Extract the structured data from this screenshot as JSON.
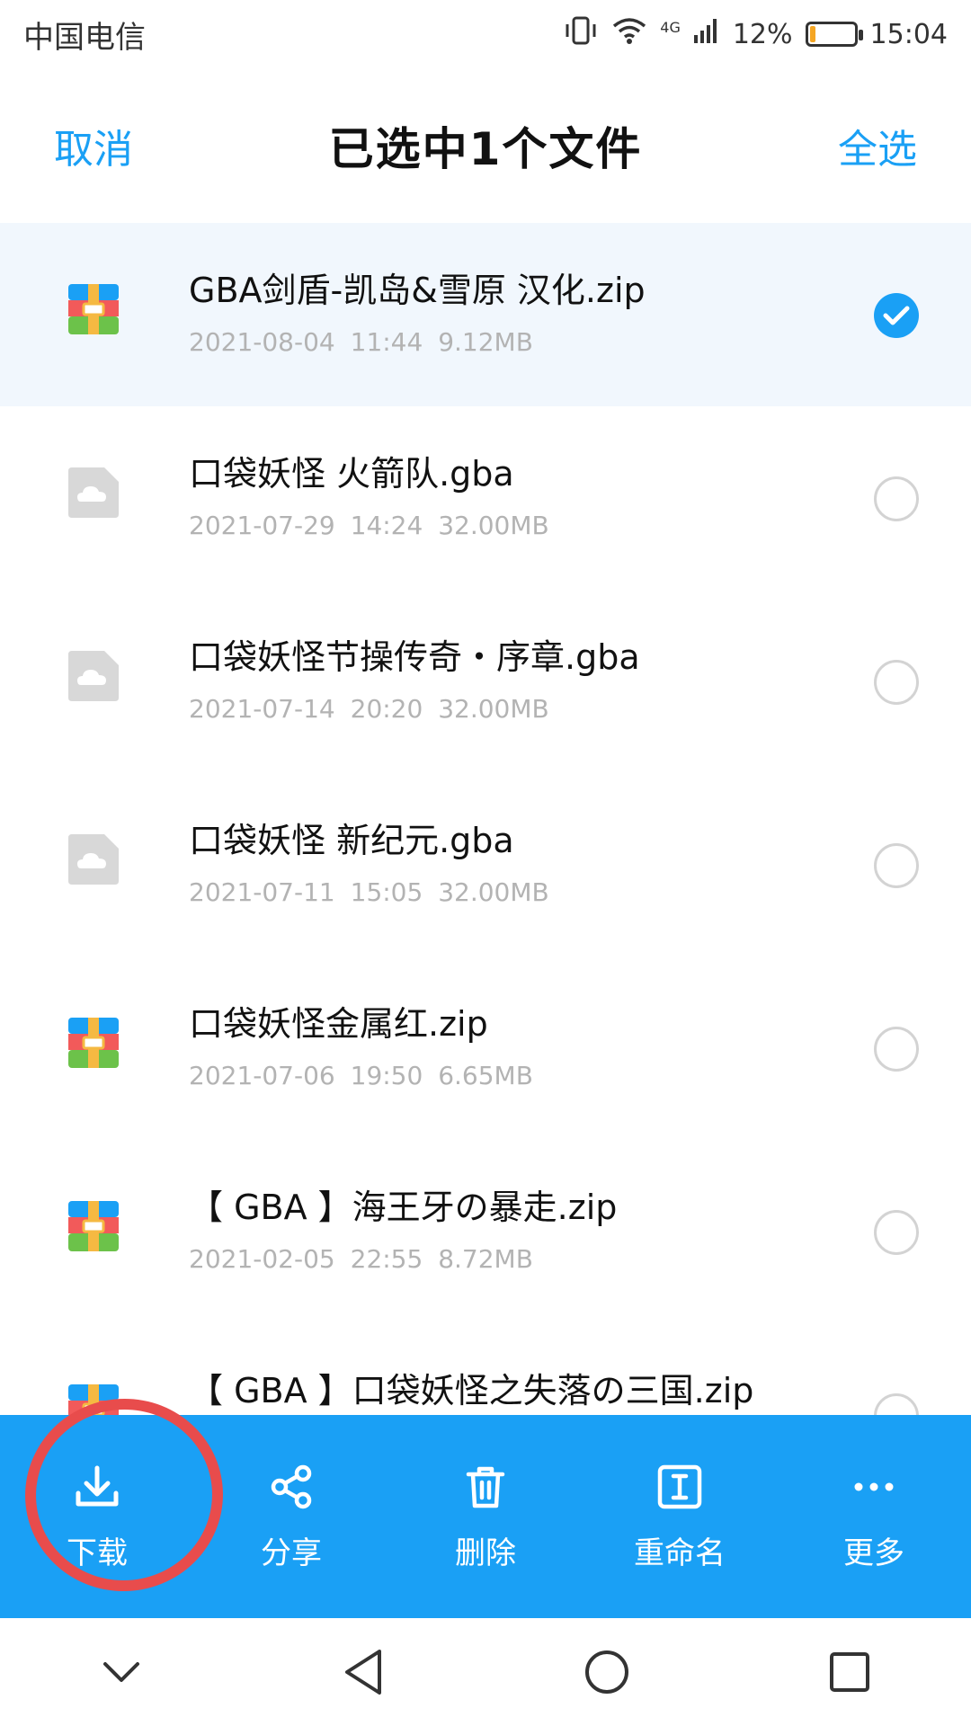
{
  "status_bar": {
    "carrier": "中国电信",
    "network": "4G",
    "battery_percent": "12%",
    "battery_level": 0.12,
    "time": "15:04"
  },
  "header": {
    "cancel_label": "取消",
    "title": "已选中1个文件",
    "select_all_label": "全选"
  },
  "files": [
    {
      "name": "GBA剑盾-凯岛&雪原 汉化.zip",
      "meta": "2021-08-04  11:44  9.12MB",
      "type": "archive",
      "selected": true
    },
    {
      "name": "口袋妖怪 火箭队.gba",
      "meta": "2021-07-29  14:24  32.00MB",
      "type": "cloud-file",
      "selected": false
    },
    {
      "name": "口袋妖怪节操传奇・序章.gba",
      "meta": "2021-07-14  20:20  32.00MB",
      "type": "cloud-file",
      "selected": false
    },
    {
      "name": "口袋妖怪 新纪元.gba",
      "meta": "2021-07-11  15:05  32.00MB",
      "type": "cloud-file",
      "selected": false
    },
    {
      "name": "口袋妖怪金属红.zip",
      "meta": "2021-07-06  19:50  6.65MB",
      "type": "archive",
      "selected": false
    },
    {
      "name": "【 GBA 】海王牙の暴走.zip",
      "meta": "2021-02-05  22:55  8.72MB",
      "type": "archive",
      "selected": false
    },
    {
      "name": "【 GBA 】口袋妖怪之失落の三国.zip",
      "meta": "",
      "type": "archive",
      "selected": false
    }
  ],
  "actions": {
    "download_label": "下载",
    "share_label": "分享",
    "delete_label": "删除",
    "rename_label": "重命名",
    "more_label": "更多"
  },
  "colors": {
    "accent": "#1aa0f5",
    "selected_row": "#f1f7fd",
    "meta_text": "#b3b3b3",
    "annotation": "#e84c4c"
  }
}
